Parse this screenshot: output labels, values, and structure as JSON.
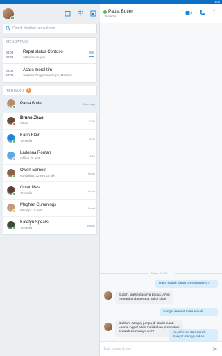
{
  "status_bar": {
    "time": "1:00"
  },
  "search": {
    "placeholder": "Cari di direktori perusahaan"
  },
  "upcoming": {
    "title": "MENDATANG",
    "meetings": [
      {
        "start": "08:00",
        "end": "08:30",
        "title": "Rapat status Contoso",
        "subtitle": "@Rafael Guyen"
      },
      {
        "start": "09:00",
        "end": "10:00",
        "title": "Acara moral tim",
        "subtitle": "Sekolah Tinggi Seni Rupa, Marietta..."
      }
    ]
  },
  "recent": {
    "title": "TERBARU",
    "badge": "1",
    "contacts": [
      {
        "name": "Paula Butler",
        "status": "",
        "time": "Baru saja",
        "presence": "#5cb85c",
        "avatar": "#b98c6c"
      },
      {
        "name": "Bruno Zhao",
        "status": "Sibuk",
        "time": "12:30",
        "presence": "#e04444",
        "avatar": "#6b4a36"
      },
      {
        "name": "Karin Blair",
        "status": "Tersedia",
        "time": "11:00",
        "presence": "#5cb85c",
        "avatar": "#1e86d9"
      },
      {
        "name": "Ladonna Roman",
        "status": "Offline 25 mnt",
        "time": "9/23",
        "presence": "#aab2b9",
        "avatar": "#5aa9e0"
      },
      {
        "name": "Owen Earnest",
        "status": "Panggilan, 32 mnt 18 dtk",
        "time": "Senin",
        "presence": "#5cb85c",
        "avatar": "#8a6248"
      },
      {
        "name": "Omar Mast",
        "status": "Tersedia",
        "time": "Senin",
        "presence": "#5cb85c",
        "avatar": "#5b4235"
      },
      {
        "name": "Meghan Cummings",
        "status": "Menelpt 19 mnt",
        "time": "Jumat",
        "presence": "#f0c419",
        "avatar": "#c49a80"
      },
      {
        "name": "Katelyn Spears",
        "status": "Tersedia",
        "time": "Kamis",
        "presence": "#5cb85c",
        "avatar": "#3d4a3a"
      }
    ]
  },
  "conversation": {
    "contact_name": "Paula Butler",
    "contact_status": "Tersedia",
    "date_divider": "Rabu, 23 Okt",
    "messages": [
      {
        "dir": "out",
        "text": "Halo, sudah dapat presentasinya?"
      },
      {
        "dir": "in",
        "text": "Sudah, presentasinya bagus. Alvin mengubah beberapa hal di slide"
      },
      {
        "dir": "out",
        "text": "Sangat keren!! Suka sekali!"
      },
      {
        "dir": "in",
        "text": "Baiklah, sampai jumpa di studio nanti. Lonnie Appel akan melakukan presentasi Apakah semuanya ikut?"
      },
      {
        "dir": "out",
        "text": "Ya, Sheree dan Sarah. Sangat menggumkan."
      }
    ],
    "composer_placeholder": "Tulis pesan di sini"
  }
}
